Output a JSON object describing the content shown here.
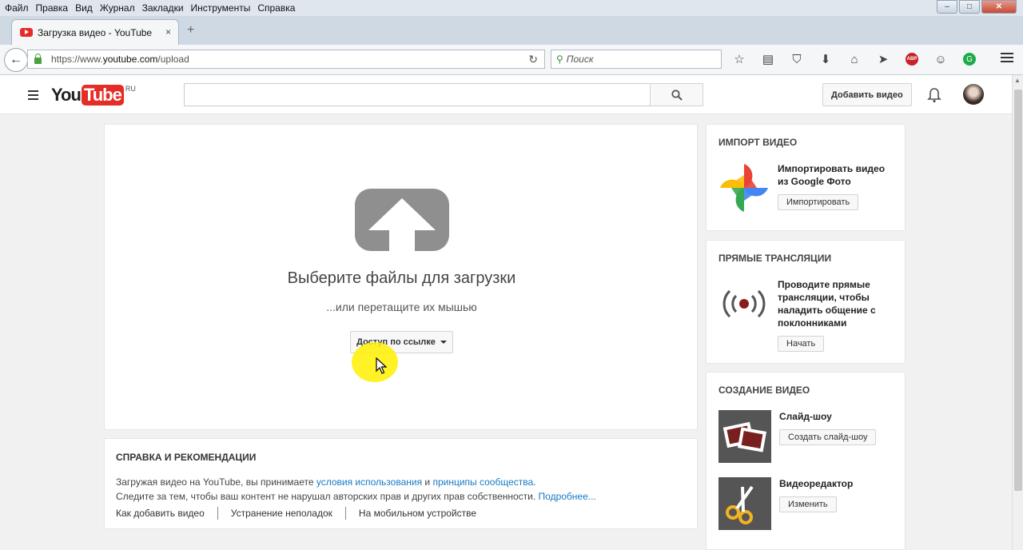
{
  "menu": [
    "Файл",
    "Правка",
    "Вид",
    "Журнал",
    "Закладки",
    "Инструменты",
    "Справка"
  ],
  "tab": {
    "title": "Загрузка видео - YouTube",
    "close": "×",
    "new": "+"
  },
  "address": {
    "prefix": "https://www.",
    "domain": "youtube.com",
    "path": "/upload"
  },
  "search_bar": {
    "placeholder": "Поиск"
  },
  "toolbar": {
    "abp": "ABP",
    "grammarly": "G"
  },
  "yt": {
    "logo_you": "You",
    "logo_tube": "Tube",
    "logo_region": "RU",
    "add_video": "Добавить видео"
  },
  "upload": {
    "title": "Выберите файлы для загрузки",
    "subtitle": "...или перетащите их мышью",
    "privacy": "Доступ по ссылке"
  },
  "help": {
    "title": "СПРАВКА И РЕКОМЕНДАЦИИ",
    "line1_a": "Загружая видео на YouTube, вы принимаете ",
    "line1_link1": "условия использования",
    "line1_b": " и ",
    "line1_link2": "принципы сообщества",
    "line1_c": ".",
    "line2_a": "Следите за тем, чтобы ваш контент не нарушал авторских прав и других прав собственности. ",
    "line2_link": "Подробнее...",
    "links": [
      "Как добавить видео",
      "Устранение неполадок",
      "На мобильном устройстве"
    ]
  },
  "sidebar": {
    "import": {
      "title": "ИМПОРТ ВИДЕО",
      "text": "Импортировать видео из Google Фото",
      "button": "Импортировать"
    },
    "live": {
      "title": "ПРЯМЫЕ ТРАНСЛЯЦИИ",
      "text": "Проводите прямые трансляции, чтобы наладить общение с поклонниками",
      "button": "Начать"
    },
    "create": {
      "title": "СОЗДАНИЕ ВИДЕО",
      "slideshow": {
        "text": "Слайд-шоу",
        "button": "Создать слайд-шоу"
      },
      "editor": {
        "text": "Видеоредактор",
        "button": "Изменить"
      }
    }
  },
  "colors": {
    "accent_red": "#e52d27",
    "link_blue": "#167ac6",
    "cursor_highlight": "#fff000"
  }
}
